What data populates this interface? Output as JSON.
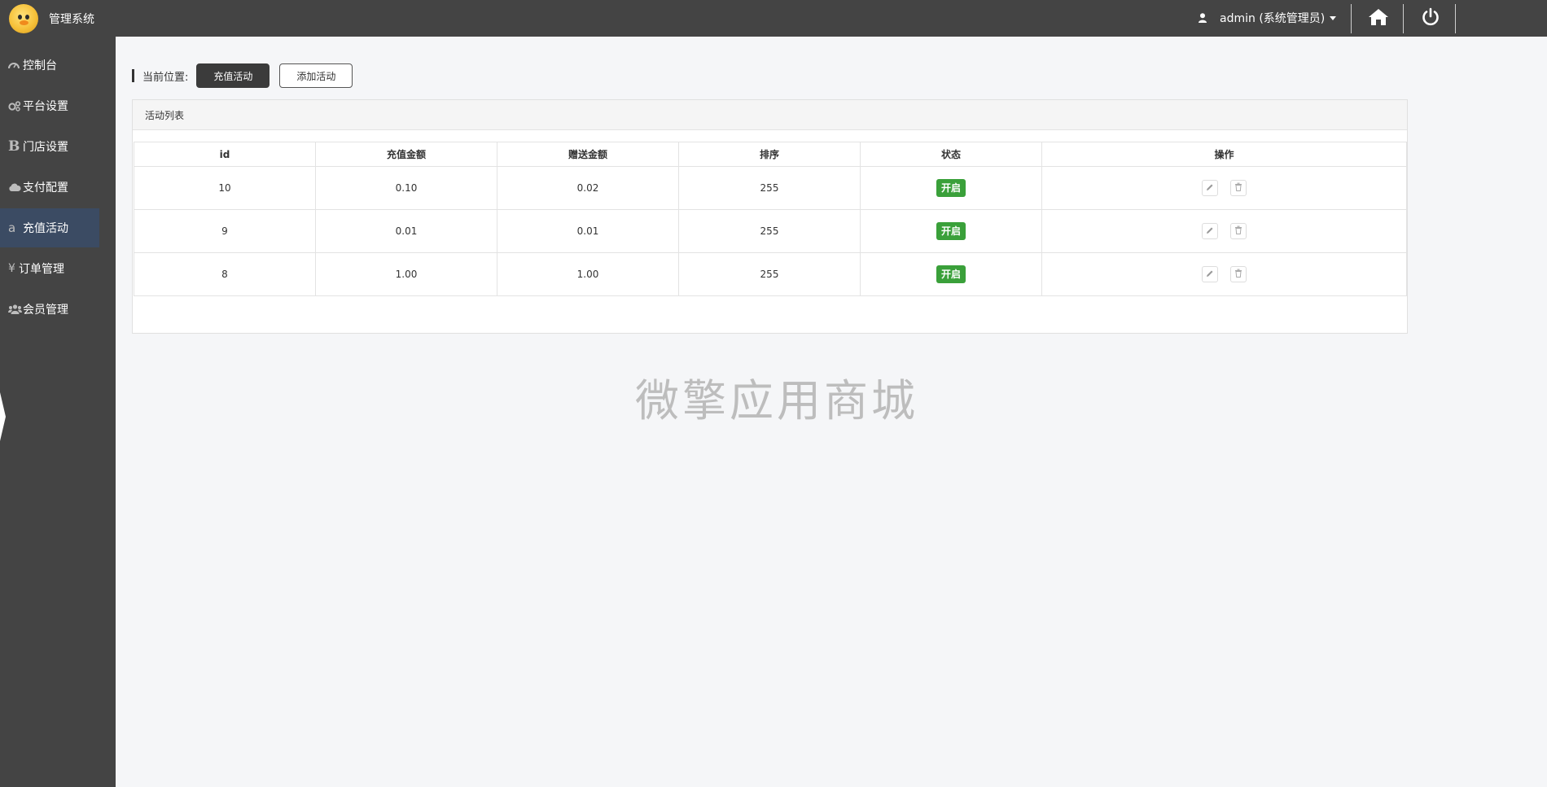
{
  "app": {
    "title": "管理系统"
  },
  "user_menu": {
    "label": "admin (系统管理员)"
  },
  "top_actions": {
    "home_icon": "home-icon",
    "power_icon": "power-icon"
  },
  "sidebar": {
    "items": [
      {
        "label": "控制台",
        "icon": "dashboard-icon",
        "active": false
      },
      {
        "label": "平台设置",
        "icon": "cogs-icon",
        "active": false
      },
      {
        "label": "门店设置",
        "icon": "bold-b-icon",
        "active": false
      },
      {
        "label": "支付配置",
        "icon": "cloud-icon",
        "active": false
      },
      {
        "label": "充值活动",
        "icon": "amazon-a-icon",
        "active": true
      },
      {
        "label": "订单管理",
        "icon": "yen-icon",
        "active": false
      },
      {
        "label": "会员管理",
        "icon": "users-icon",
        "active": false
      }
    ]
  },
  "breadcrumb": {
    "label": "当前位置:",
    "current": "充值活动",
    "add_button": "添加活动"
  },
  "panel": {
    "title": "活动列表",
    "columns": [
      "id",
      "充值金额",
      "赠送金额",
      "排序",
      "状态",
      "操作"
    ],
    "rows": [
      {
        "id": "10",
        "amount": "0.10",
        "bonus": "0.02",
        "sort": "255",
        "status": "开启"
      },
      {
        "id": "9",
        "amount": "0.01",
        "bonus": "0.01",
        "sort": "255",
        "status": "开启"
      },
      {
        "id": "8",
        "amount": "1.00",
        "bonus": "1.00",
        "sort": "255",
        "status": "开启"
      }
    ]
  },
  "watermark": "微擎应用商城",
  "colors": {
    "topbar": "#444444",
    "sidebar": "#444444",
    "active_nav": "#3b4b63",
    "status_on": "#3aa03a"
  }
}
